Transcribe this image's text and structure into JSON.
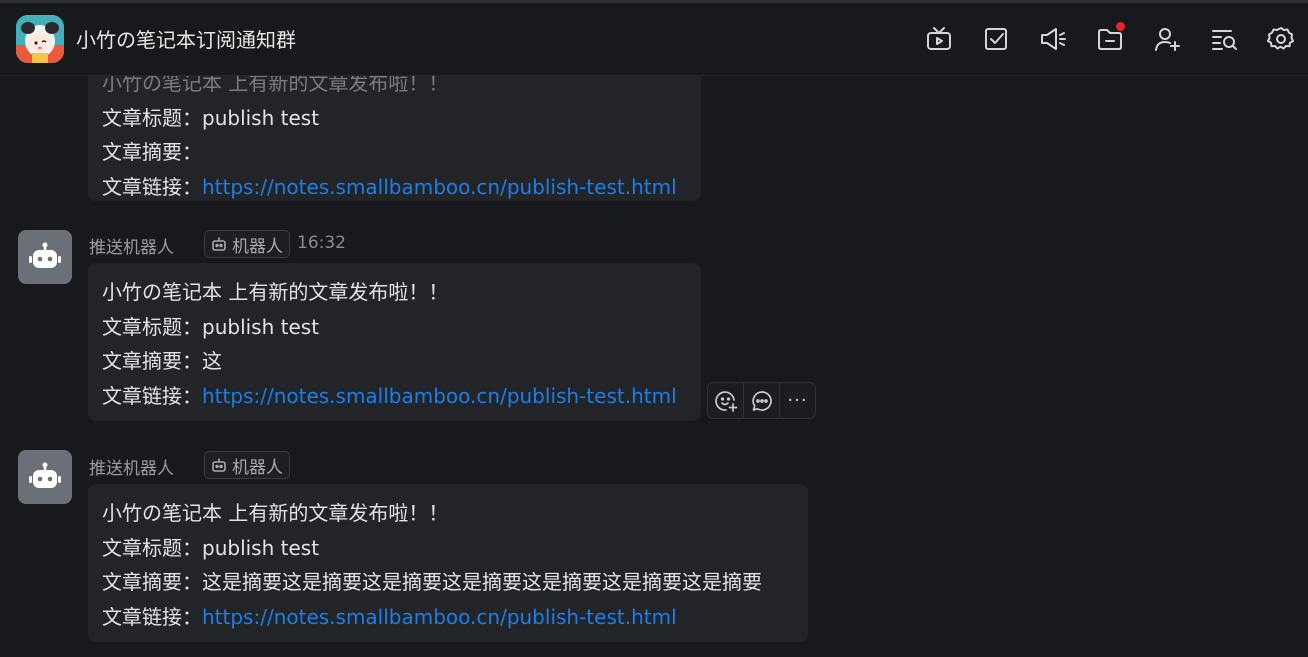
{
  "header": {
    "title": "小竹の笔记本订阅通知群",
    "icons": [
      "tv-icon",
      "checkbox-icon",
      "announcement-icon",
      "folder-icon",
      "add-member-icon",
      "search-history-icon",
      "settings-icon"
    ]
  },
  "messages": [
    {
      "partial_top": "小竹の笔记本 上有新的文章发布啦！！",
      "lines": [
        {
          "label": "文章标题：",
          "value": "publish test"
        },
        {
          "label": "文章摘要：",
          "value": ""
        },
        {
          "label": "文章链接：",
          "link": "https://notes.smallbamboo.cn/publish-test.html"
        }
      ]
    },
    {
      "sender": "推送机器人",
      "tag": "机器人",
      "time": "16:32",
      "lines": [
        {
          "text": "小竹の笔记本 上有新的文章发布啦！！"
        },
        {
          "label": "文章标题：",
          "value": "publish test"
        },
        {
          "label": "文章摘要：",
          "value": "这"
        },
        {
          "label": "文章链接：",
          "link": "https://notes.smallbamboo.cn/publish-test.html"
        }
      ]
    },
    {
      "sender": "推送机器人",
      "tag": "机器人",
      "lines": [
        {
          "text": "小竹の笔记本 上有新的文章发布啦！！"
        },
        {
          "label": "文章标题：",
          "value": "publish test"
        },
        {
          "label": "文章摘要：",
          "value": "这是摘要这是摘要这是摘要这是摘要这是摘要这是摘要这是摘要"
        },
        {
          "label": "文章链接：",
          "link": "https://notes.smallbamboo.cn/publish-test.html"
        }
      ]
    }
  ],
  "hover_actions": {
    "more_label": "···"
  },
  "colors": {
    "background": "#18191c",
    "bubble": "#222428",
    "link": "#1a7fe8",
    "notification_dot": "#e8252b",
    "bot_avatar": "#6b7078"
  }
}
